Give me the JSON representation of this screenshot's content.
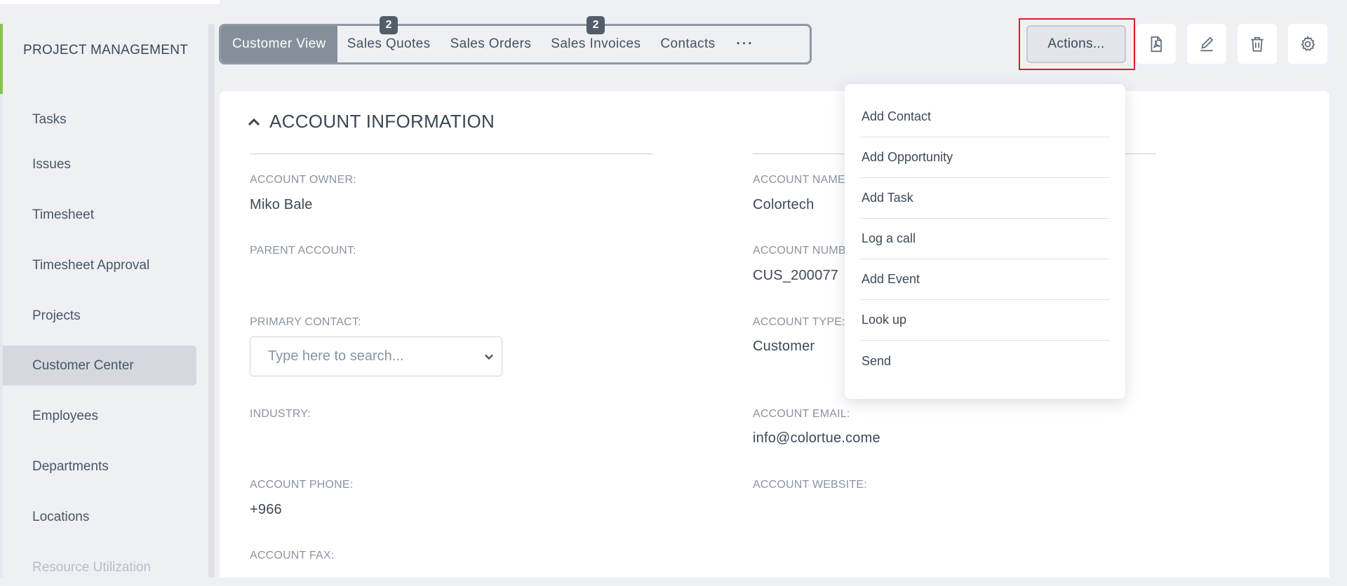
{
  "sidebar": {
    "header": "PROJECT MANAGEMENT",
    "items": [
      {
        "label": "Tasks"
      },
      {
        "label": "Issues"
      },
      {
        "label": "Timesheet"
      },
      {
        "label": "Timesheet Approval"
      },
      {
        "label": "Projects"
      },
      {
        "label": "Customer Center",
        "active": true
      },
      {
        "label": "Employees"
      },
      {
        "label": "Departments"
      },
      {
        "label": "Locations"
      },
      {
        "label": "Resource Utilization"
      }
    ]
  },
  "tabs": [
    {
      "label": "Customer View",
      "active": true
    },
    {
      "label": "Sales Quotes",
      "badge": "2"
    },
    {
      "label": "Sales Orders"
    },
    {
      "label": "Sales Invoices",
      "badge": "2"
    },
    {
      "label": "Contacts"
    },
    {
      "label": "···"
    }
  ],
  "toolbar": {
    "actions_label": "Actions...",
    "icons": [
      "pdf-icon",
      "edit-icon",
      "trash-icon",
      "gear-icon"
    ]
  },
  "section": {
    "title": "ACCOUNT INFORMATION",
    "fields": {
      "account_owner_label": "ACCOUNT OWNER:",
      "account_owner_value": "Miko Bale",
      "account_name_label": "ACCOUNT NAME",
      "account_name_value": "Colortech",
      "parent_account_label": "PARENT ACCOUNT:",
      "account_number_label": "ACCOUNT NUMBE",
      "account_number_value": "CUS_200077",
      "primary_contact_label": "PRIMARY CONTACT:",
      "primary_contact_placeholder": "Type here to search...",
      "account_type_label": "ACCOUNT TYPE:",
      "account_type_value": "Customer",
      "industry_label": "INDUSTRY:",
      "account_email_label": "ACCOUNT EMAIL:",
      "account_email_value": "info@colortue.come",
      "account_phone_label": "ACCOUNT PHONE:",
      "account_phone_value": "+966",
      "account_website_label": "ACCOUNT WEBSITE:",
      "account_fax_label": "ACCOUNT FAX:"
    }
  },
  "actions_menu": [
    {
      "label": "Add Contact"
    },
    {
      "label": "Add Opportunity"
    },
    {
      "label": "Add Task"
    },
    {
      "label": "Log a call"
    },
    {
      "label": "Add Event"
    },
    {
      "label": "Look up"
    },
    {
      "label": "Send"
    }
  ],
  "colors": {
    "accent_green": "#8bc34a",
    "highlight_red": "#e01b24",
    "active_tab": "#858f9c"
  }
}
